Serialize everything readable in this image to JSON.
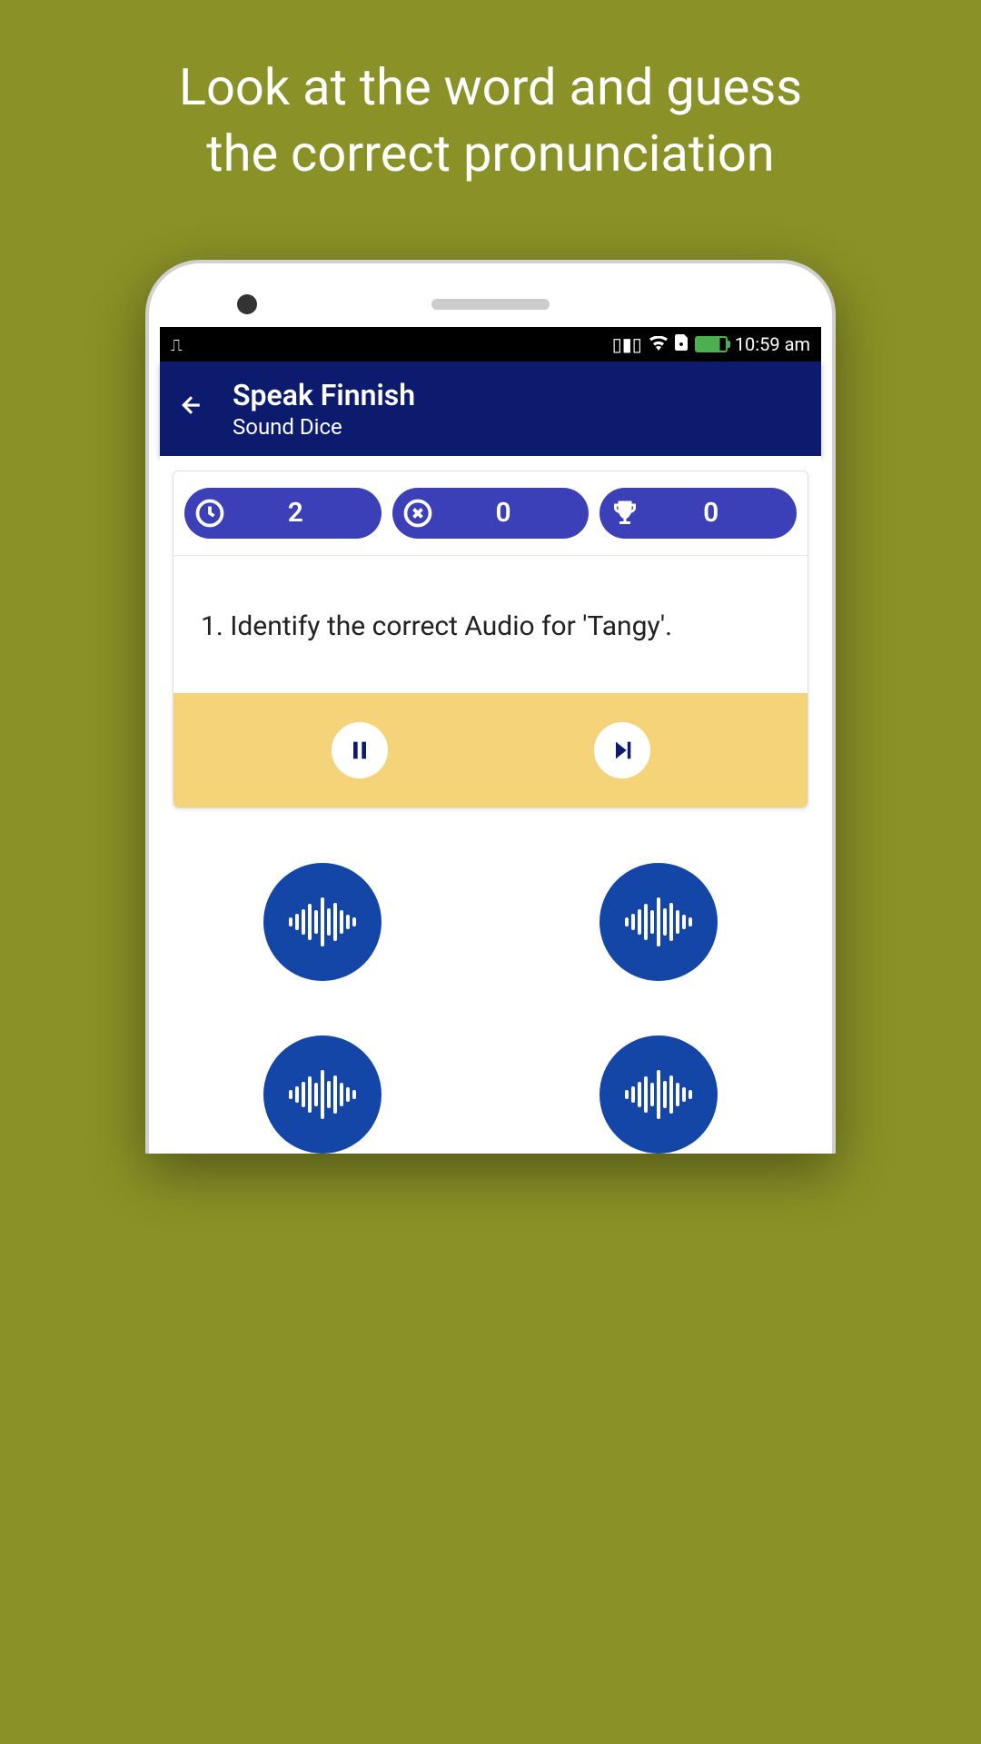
{
  "promo": {
    "line1": "Look at the word and guess",
    "line2": "the correct pronunciation"
  },
  "status_bar": {
    "time": "10:59 am"
  },
  "header": {
    "title": "Speak Finnish",
    "subtitle": "Sound Dice"
  },
  "stats": {
    "timer": "2",
    "wrong": "0",
    "trophy": "0"
  },
  "question": {
    "text": "1. Identify the correct Audio for 'Tangy'."
  }
}
